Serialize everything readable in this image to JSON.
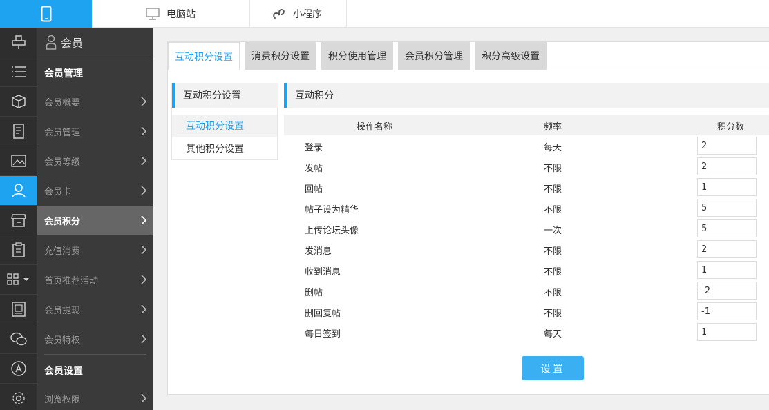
{
  "topbar": {
    "pc_label": "电脑站",
    "mini_label": "小程序"
  },
  "sidebar": {
    "head_label": "会员",
    "group1": "会员管理",
    "items": [
      {
        "label": "会员概要"
      },
      {
        "label": "会员管理"
      },
      {
        "label": "会员等级"
      },
      {
        "label": "会员卡"
      },
      {
        "label": "会员积分"
      },
      {
        "label": "充值消费"
      },
      {
        "label": "首页推荐活动"
      },
      {
        "label": "会员提现"
      },
      {
        "label": "会员特权"
      }
    ],
    "group2": "会员设置",
    "items2": [
      {
        "label": "浏览权限"
      }
    ]
  },
  "tabs": [
    {
      "label": "互动积分设置"
    },
    {
      "label": "消费积分设置"
    },
    {
      "label": "积分使用管理"
    },
    {
      "label": "会员积分管理"
    },
    {
      "label": "积分高级设置"
    }
  ],
  "subnav": {
    "title": "互动积分设置",
    "items": [
      {
        "label": "互动积分设置"
      },
      {
        "label": "其他积分设置"
      }
    ]
  },
  "panel": {
    "title": "互动积分",
    "headers": {
      "name": "操作名称",
      "freq": "频率",
      "points": "积分数"
    },
    "rows": [
      {
        "name": "登录",
        "freq": "每天",
        "points": "2"
      },
      {
        "name": "发帖",
        "freq": "不限",
        "points": "2"
      },
      {
        "name": "回帖",
        "freq": "不限",
        "points": "1"
      },
      {
        "name": "帖子设为精华",
        "freq": "不限",
        "points": "5"
      },
      {
        "name": "上传论坛头像",
        "freq": "一次",
        "points": "5"
      },
      {
        "name": "发消息",
        "freq": "不限",
        "points": "2"
      },
      {
        "name": "收到消息",
        "freq": "不限",
        "points": "1"
      },
      {
        "name": "删帖",
        "freq": "不限",
        "points": "-2"
      },
      {
        "name": "删回复帖",
        "freq": "不限",
        "points": "-1"
      },
      {
        "name": "每日签到",
        "freq": "每天",
        "points": "1"
      }
    ],
    "save_label": "设置"
  },
  "colors": {
    "accent": "#1ea3f0",
    "rail_bg": "#2e2e2e",
    "sidebar_bg": "#3a3a3a"
  }
}
